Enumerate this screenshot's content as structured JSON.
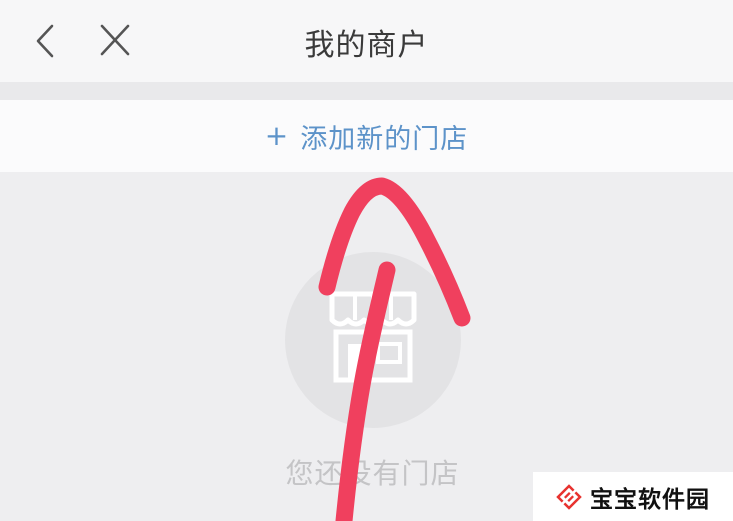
{
  "nav": {
    "title": "我的商户",
    "back_icon": "chevron-left-icon",
    "close_icon": "close-icon"
  },
  "add_store": {
    "plus": "+",
    "label": "添加新的门店"
  },
  "empty_state": {
    "icon": "store-icon",
    "text": "您还没有门店"
  },
  "annotation": {
    "type": "hand-drawn arrow pointing up",
    "color": "#f0405e"
  },
  "watermark": {
    "text": "宝宝软件园",
    "logo_color": "#e8322f"
  },
  "colors": {
    "accent": "#5d93c9",
    "background": "#efeff1"
  }
}
